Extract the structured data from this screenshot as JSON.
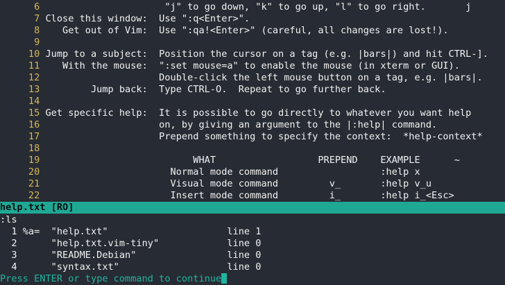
{
  "help_buffer": {
    "lines": [
      {
        "num": "6",
        "text": "                     \"j\" to go down, \"k\" to go up, \"l\" to go right.       j"
      },
      {
        "num": "7",
        "text": "Close this window:  Use \":q<Enter>\"."
      },
      {
        "num": "8",
        "text": "   Get out of Vim:  Use \":qa!<Enter>\" (careful, all changes are lost!)."
      },
      {
        "num": "9",
        "text": ""
      },
      {
        "num": "10",
        "text": "Jump to a subject:  Position the cursor on a tag (e.g. |bars|) and hit CTRL-]."
      },
      {
        "num": "11",
        "text": "   With the mouse:  \":set mouse=a\" to enable the mouse (in xterm or GUI)."
      },
      {
        "num": "12",
        "text": "                    Double-click the left mouse button on a tag, e.g. |bars|."
      },
      {
        "num": "13",
        "text": "        Jump back:  Type CTRL-O.  Repeat to go further back."
      },
      {
        "num": "14",
        "text": ""
      },
      {
        "num": "15",
        "text": "Get specific help:  It is possible to go directly to whatever you want help"
      },
      {
        "num": "16",
        "text": "                    on, by giving an argument to the |:help| command."
      },
      {
        "num": "17",
        "text": "                    Prepend something to specify the context:  *help-context*"
      },
      {
        "num": "18",
        "text": ""
      },
      {
        "num": "19",
        "text": "                          WHAT                  PREPEND    EXAMPLE      ~"
      },
      {
        "num": "20",
        "text": "                      Normal mode command                  :help x"
      },
      {
        "num": "21",
        "text": "                      Visual mode command         v_       :help v_u"
      },
      {
        "num": "22",
        "text": "                      Insert mode command         i_       :help i_<Esc>"
      }
    ]
  },
  "status_line": {
    "label": "help.txt [RO]"
  },
  "ls_output": {
    "command": ":ls",
    "buffers": [
      {
        "line": "  1 %a=  \"help.txt\"                     line 1"
      },
      {
        "line": "  2      \"help.txt.vim-tiny\"            line 0"
      },
      {
        "line": "  3      \"README.Debian\"                line 0"
      },
      {
        "line": "  4      \"syntax.txt\"                   line 0"
      }
    ]
  },
  "prompt": {
    "text": "Press ENTER or type command to continue"
  },
  "colors": {
    "background": "#272b33",
    "line_number": "#d6b85a",
    "status_bar": "#1fa995",
    "prompt": "#1fb5a0"
  }
}
